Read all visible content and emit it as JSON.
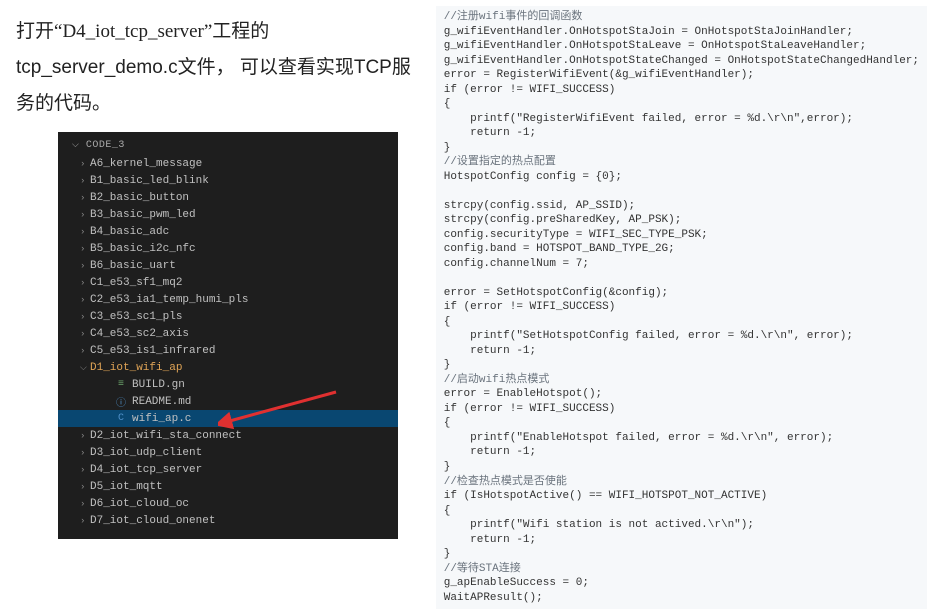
{
  "instruction": {
    "part1": "打开",
    "quoted": "“D4_iot_tcp_server”",
    "part2": "工程的tcp_server_demo.c文件， 可以查看实现TCP服务的代码。"
  },
  "tree": {
    "header": "CODE_3",
    "items": [
      {
        "chev": "›",
        "icon": "",
        "label": "A6_kernel_message",
        "nested": true,
        "cls": ""
      },
      {
        "chev": "›",
        "icon": "",
        "label": "B1_basic_led_blink",
        "nested": true,
        "cls": ""
      },
      {
        "chev": "›",
        "icon": "",
        "label": "B2_basic_button",
        "nested": true,
        "cls": ""
      },
      {
        "chev": "›",
        "icon": "",
        "label": "B3_basic_pwm_led",
        "nested": true,
        "cls": ""
      },
      {
        "chev": "›",
        "icon": "",
        "label": "B4_basic_adc",
        "nested": true,
        "cls": ""
      },
      {
        "chev": "›",
        "icon": "",
        "label": "B5_basic_i2c_nfc",
        "nested": true,
        "cls": ""
      },
      {
        "chev": "›",
        "icon": "",
        "label": "B6_basic_uart",
        "nested": true,
        "cls": ""
      },
      {
        "chev": "›",
        "icon": "",
        "label": "C1_e53_sf1_mq2",
        "nested": true,
        "cls": ""
      },
      {
        "chev": "›",
        "icon": "",
        "label": "C2_e53_ia1_temp_humi_pls",
        "nested": true,
        "cls": ""
      },
      {
        "chev": "›",
        "icon": "",
        "label": "C3_e53_sc1_pls",
        "nested": true,
        "cls": ""
      },
      {
        "chev": "›",
        "icon": "",
        "label": "C4_e53_sc2_axis",
        "nested": true,
        "cls": ""
      },
      {
        "chev": "›",
        "icon": "",
        "label": "C5_e53_is1_infrared",
        "nested": true,
        "cls": ""
      },
      {
        "chev": "⌵",
        "icon": "",
        "label": "D1_iot_wifi_ap",
        "nested": true,
        "cls": "orange"
      },
      {
        "chev": "",
        "icon": "≡",
        "iconCls": "build",
        "label": "BUILD.gn",
        "nested": true,
        "cls": "nested2"
      },
      {
        "chev": "",
        "icon": "ⓘ",
        "iconCls": "md",
        "label": "README.md",
        "nested": true,
        "cls": "nested2"
      },
      {
        "chev": "",
        "icon": "C",
        "iconCls": "c",
        "label": "wifi_ap.c",
        "nested": true,
        "cls": "nested2 selected",
        "hasArrow": true
      },
      {
        "chev": "›",
        "icon": "",
        "label": "D2_iot_wifi_sta_connect",
        "nested": true,
        "cls": ""
      },
      {
        "chev": "›",
        "icon": "",
        "label": "D3_iot_udp_client",
        "nested": true,
        "cls": ""
      },
      {
        "chev": "›",
        "icon": "",
        "label": "D4_iot_tcp_server",
        "nested": true,
        "cls": ""
      },
      {
        "chev": "›",
        "icon": "",
        "label": "D5_iot_mqtt",
        "nested": true,
        "cls": ""
      },
      {
        "chev": "›",
        "icon": "",
        "label": "D6_iot_cloud_oc",
        "nested": true,
        "cls": ""
      },
      {
        "chev": "›",
        "icon": "",
        "label": "D7_iot_cloud_onenet",
        "nested": true,
        "cls": ""
      }
    ]
  },
  "code": {
    "lines": [
      {
        "t": "//注册wifi事件的回调函数",
        "c": true
      },
      {
        "t": "g_wifiEventHandler.OnHotspotStaJoin = OnHotspotStaJoinHandler;"
      },
      {
        "t": "g_wifiEventHandler.OnHotspotStaLeave = OnHotspotStaLeaveHandler;"
      },
      {
        "t": "g_wifiEventHandler.OnHotspotStateChanged = OnHotspotStateChangedHandler;"
      },
      {
        "t": "error = RegisterWifiEvent(&g_wifiEventHandler);"
      },
      {
        "t": "if (error != WIFI_SUCCESS)"
      },
      {
        "t": "{"
      },
      {
        "t": "    printf(\"RegisterWifiEvent failed, error = %d.\\r\\n\",error);"
      },
      {
        "t": "    return -1;"
      },
      {
        "t": "}"
      },
      {
        "t": "//设置指定的热点配置",
        "c": true
      },
      {
        "t": "HotspotConfig config = {0};"
      },
      {
        "t": ""
      },
      {
        "t": "strcpy(config.ssid, AP_SSID);"
      },
      {
        "t": "strcpy(config.preSharedKey, AP_PSK);"
      },
      {
        "t": "config.securityType = WIFI_SEC_TYPE_PSK;"
      },
      {
        "t": "config.band = HOTSPOT_BAND_TYPE_2G;"
      },
      {
        "t": "config.channelNum = 7;"
      },
      {
        "t": ""
      },
      {
        "t": "error = SetHotspotConfig(&config);"
      },
      {
        "t": "if (error != WIFI_SUCCESS)"
      },
      {
        "t": "{"
      },
      {
        "t": "    printf(\"SetHotspotConfig failed, error = %d.\\r\\n\", error);"
      },
      {
        "t": "    return -1;"
      },
      {
        "t": "}"
      },
      {
        "t": "//启动wifi热点模式",
        "c": true
      },
      {
        "t": "error = EnableHotspot();"
      },
      {
        "t": "if (error != WIFI_SUCCESS)"
      },
      {
        "t": "{"
      },
      {
        "t": "    printf(\"EnableHotspot failed, error = %d.\\r\\n\", error);"
      },
      {
        "t": "    return -1;"
      },
      {
        "t": "}"
      },
      {
        "t": "//检查热点模式是否使能",
        "c": true
      },
      {
        "t": "if (IsHotspotActive() == WIFI_HOTSPOT_NOT_ACTIVE)"
      },
      {
        "t": "{"
      },
      {
        "t": "    printf(\"Wifi station is not actived.\\r\\n\");"
      },
      {
        "t": "    return -1;"
      },
      {
        "t": "}"
      },
      {
        "t": "//等待STA连接",
        "c": true
      },
      {
        "t": "g_apEnableSuccess = 0;"
      },
      {
        "t": "WaitAPResult();"
      }
    ]
  }
}
